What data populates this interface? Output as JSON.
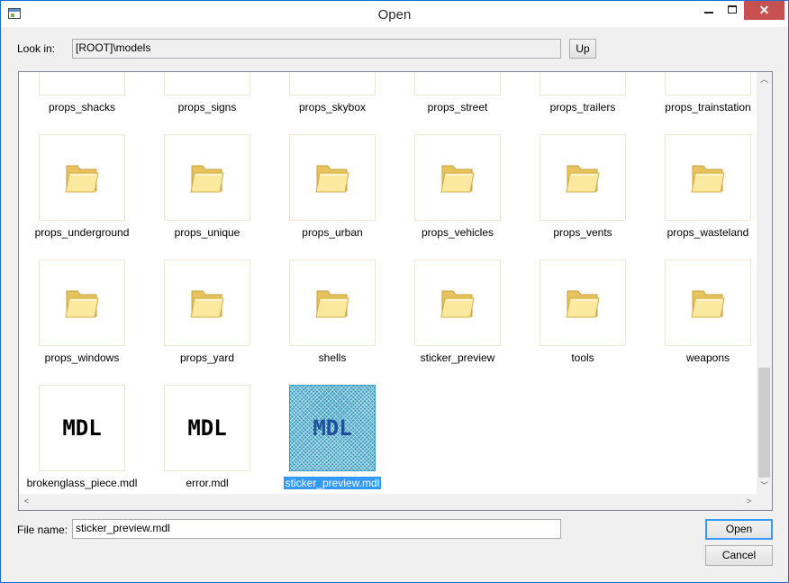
{
  "window": {
    "title": "Open",
    "close_glyph": "✕"
  },
  "lookin": {
    "label": "Look in:",
    "value": "[ROOT]\\models",
    "up_label": "Up"
  },
  "items": [
    {
      "name": "props_shacks",
      "type": "folder"
    },
    {
      "name": "props_signs",
      "type": "folder"
    },
    {
      "name": "props_skybox",
      "type": "folder"
    },
    {
      "name": "props_street",
      "type": "folder"
    },
    {
      "name": "props_trailers",
      "type": "folder"
    },
    {
      "name": "props_trainstation",
      "type": "folder"
    },
    {
      "name": "props_underground",
      "type": "folder"
    },
    {
      "name": "props_unique",
      "type": "folder"
    },
    {
      "name": "props_urban",
      "type": "folder"
    },
    {
      "name": "props_vehicles",
      "type": "folder"
    },
    {
      "name": "props_vents",
      "type": "folder"
    },
    {
      "name": "props_wasteland",
      "type": "folder"
    },
    {
      "name": "props_windows",
      "type": "folder"
    },
    {
      "name": "props_yard",
      "type": "folder"
    },
    {
      "name": "shells",
      "type": "folder"
    },
    {
      "name": "sticker_preview",
      "type": "folder"
    },
    {
      "name": "tools",
      "type": "folder"
    },
    {
      "name": "weapons",
      "type": "folder"
    },
    {
      "name": "brokenglass_piece.mdl",
      "type": "mdl",
      "thumb_text": "MDL"
    },
    {
      "name": "error.mdl",
      "type": "mdl",
      "thumb_text": "MDL"
    },
    {
      "name": "sticker_preview.mdl",
      "type": "mdl",
      "thumb_text": "MDL",
      "selected": true
    }
  ],
  "filename": {
    "label": "File name:",
    "value": "sticker_preview.mdl"
  },
  "buttons": {
    "open_label": "Open",
    "cancel_label": "Cancel"
  },
  "scrollbar": {
    "up_glyph": "︿",
    "down_glyph": "﹀",
    "left_glyph": "<",
    "right_glyph": ">"
  },
  "colors": {
    "selection": "#3399ff",
    "folder_light": "#fbe9a0",
    "folder_dark": "#e8c25c"
  }
}
